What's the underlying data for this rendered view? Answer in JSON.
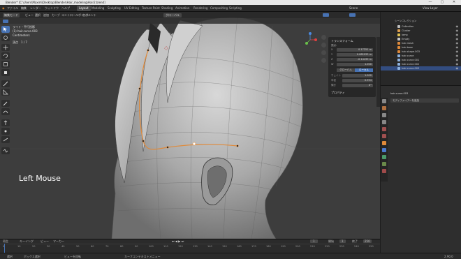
{
  "window": {
    "title": "Blender* [C:\\Users\\Maxim\\Desktop\\Blender\\Hair_modeling\\Hair2.blend]",
    "controls": [
      "—",
      "▢",
      "✕"
    ]
  },
  "menubar": {
    "menus": [
      "ファイル",
      "編集",
      "レンダー",
      "ウィンドウ",
      "ヘルプ"
    ],
    "workspaces": [
      "Layout",
      "Modeling",
      "Sculpting",
      "UV Editing",
      "Texture Paint",
      "Shading",
      "Animation",
      "Rendering",
      "Compositing",
      "Scripting"
    ],
    "active_workspace": "Layout",
    "scene_label": "Scene",
    "view_layer_label": "View Layer"
  },
  "viewport": {
    "header": {
      "mode": "編集モード",
      "view_menus": [
        "ビュー",
        "選択",
        "追加",
        "カーブ",
        "コントロールポイント",
        "セグメント"
      ],
      "pivot": "グローバル"
    },
    "info": {
      "view": "ライト・平行投影",
      "object": "(1) hair.curve.003",
      "unit": "Centimeters",
      "vertices": "頂点　1 / 7"
    },
    "overlay_text": "Left Mouse"
  },
  "npanel": {
    "title": "トランスフォーム",
    "section": "頂点:",
    "fields": [
      {
        "label": "X",
        "value": "0.17251 m"
      },
      {
        "label": "Y",
        "value": "0.082933 m"
      },
      {
        "label": "Z",
        "value": "-0.14439 m"
      },
      {
        "label": "W",
        "value": "1.000"
      }
    ],
    "space_buttons": [
      "グローバル",
      "ローカル"
    ],
    "props": [
      {
        "label": "ウェイト",
        "value": "1.000"
      },
      {
        "label": "半径",
        "value": "0.994"
      },
      {
        "label": "傾き",
        "value": "0°"
      }
    ],
    "properties_title": "プロパティ"
  },
  "outliner": {
    "title": "シーンコレクション",
    "items": [
      {
        "label": "Collection",
        "color": "#bdbdbd"
      },
      {
        "label": "Cluster",
        "color": "#e0a050"
      },
      {
        "label": "lamp",
        "color": "#e0c050"
      },
      {
        "label": "Empty",
        "color": "#c8c8c8"
      },
      {
        "label": "hair.mesh",
        "color": "#e08a3a"
      },
      {
        "label": "hair.base",
        "color": "#e08a3a"
      },
      {
        "label": "hair.shape.003",
        "color": "#e08a3a"
      },
      {
        "label": "hair.curve",
        "color": "#8fb3e0"
      },
      {
        "label": "hair.curve.001",
        "color": "#8fb3e0"
      },
      {
        "label": "hair.curve.002",
        "color": "#8fb3e0"
      },
      {
        "label": "hair.curve.003",
        "color": "#8fb3e0"
      }
    ],
    "selected_index": 10
  },
  "properties": {
    "object_name": "hair.curve.003",
    "modifier_dropdown": "モディファイアーを追加"
  },
  "timeline": {
    "menus": [
      "再生",
      "キーイング",
      "ビュー",
      "マーカー"
    ],
    "frame_numbers": [
      "0",
      "10",
      "20",
      "30",
      "40",
      "50",
      "60",
      "70",
      "80",
      "90",
      "100",
      "110",
      "120",
      "130",
      "140",
      "150",
      "160",
      "170",
      "180",
      "190",
      "200",
      "210",
      "220",
      "230",
      "240",
      "250"
    ],
    "current_frame": "1",
    "start_label": "開始",
    "start_value": "1",
    "end_label": "終了",
    "end_value": "250"
  },
  "statusbar": {
    "items": [
      "選択",
      "ボックス選択",
      "ビューを回転",
      "カーブコンテキストメニュー"
    ],
    "version": "2.90.0"
  },
  "colors": {
    "accent": "#4772b3",
    "curve": "#e08a3a",
    "selected": "#334d80"
  }
}
